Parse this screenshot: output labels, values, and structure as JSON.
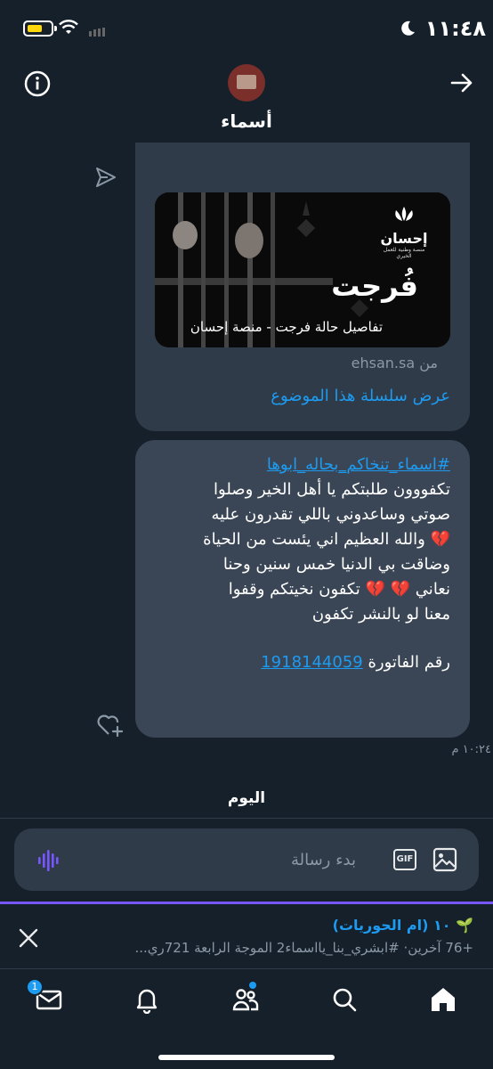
{
  "status_bar": {
    "time": "١١:٤٨"
  },
  "header": {
    "contact_name": "أسماء"
  },
  "shared_tweet": {
    "image_title": "فُرجت",
    "image_caption": "تفاصيل حالة فرجت - منصة إحسان",
    "logo_name": "إحسان",
    "logo_tagline": "منصة وطنية للعمل الخيري",
    "from_label": "من",
    "domain": "ehsan.sa",
    "thread_link": "عرض سلسلة هذا الموضوع"
  },
  "message": {
    "hashtag": "#اسماء_تنخاكم_بحاله_ابوها",
    "lines": [
      "تكفووون طلبتكم يا أهل الخير وصلوا",
      "صوتي وساعدوني باللي تقدرون عليه",
      "💔 والله العظيم اني يئست من الحياة",
      "وضاقت بي الدنيا خمس سنين وحنا",
      "نعاني 💔 💔 تكفون نخيتكم وقفوا",
      "معنا لو بالنشر تكفون"
    ],
    "invoice_label": "رقم الفاتورة",
    "invoice_number": "1918144059",
    "time": "١٠:٢٤ م"
  },
  "day_separator": "اليوم",
  "composer": {
    "placeholder": "بدء رسالة",
    "gif_label": "GIF"
  },
  "trend": {
    "leaf": "🌱",
    "title": "١٠ (ام الحوريات)",
    "subtitle": "+76 آخرين· #ابشري_بنا_يااسماء2 الموجة الرابعة 721ري..."
  },
  "nav": {
    "messages_badge": "1"
  },
  "icons": {
    "info": "info-icon",
    "forward": "arrow-right-icon",
    "send": "send-icon",
    "react": "heart-plus-icon",
    "audio": "audio-wave-icon",
    "gif": "gif-icon",
    "image": "image-icon",
    "close": "close-icon",
    "messages": "envelope-icon",
    "notifications": "bell-icon",
    "communities": "people-icon",
    "search": "search-icon",
    "home": "home-icon"
  },
  "colors": {
    "background": "#15202b",
    "accent": "#1d9bf0",
    "bubble": "#3a4655",
    "banner_accent": "#7856ff"
  }
}
